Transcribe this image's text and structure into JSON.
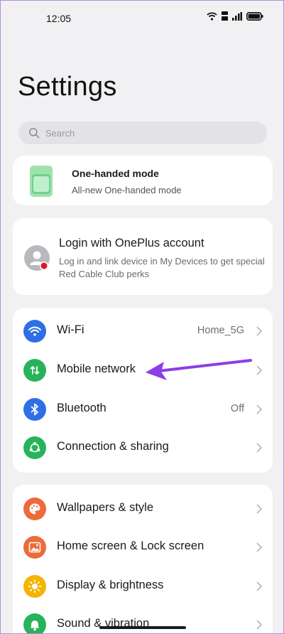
{
  "status_bar": {
    "time": "12:05"
  },
  "page": {
    "title": "Settings"
  },
  "search": {
    "placeholder": "Search"
  },
  "promo_card": {
    "title": "One-handed mode",
    "subtitle": "All-new One-handed mode"
  },
  "account_card": {
    "title": "Login with OnePlus account",
    "subtitle": "Log in and link device in My Devices to get special Red Cable Club perks"
  },
  "connectivity": [
    {
      "label": "Wi-Fi",
      "value": "Home_5G",
      "icon": "wifi-icon",
      "color": "#2f6fe4"
    },
    {
      "label": "Mobile network",
      "value": "",
      "icon": "mobile-data-icon",
      "color": "#27b35a"
    },
    {
      "label": "Bluetooth",
      "value": "Off",
      "icon": "bluetooth-icon",
      "color": "#2f6fe4"
    },
    {
      "label": "Connection & sharing",
      "value": "",
      "icon": "share-icon",
      "color": "#27b35a"
    }
  ],
  "personalization": [
    {
      "label": "Wallpapers & style",
      "icon": "palette-icon",
      "color": "#ee6a3a"
    },
    {
      "label": "Home screen & Lock screen",
      "icon": "image-icon",
      "color": "#ee6a3a"
    },
    {
      "label": "Display & brightness",
      "icon": "brightness-icon",
      "color": "#f4b400"
    },
    {
      "label": "Sound & vibration",
      "icon": "bell-icon",
      "color": "#27b35a"
    }
  ],
  "colors": {
    "accent_purple": "#8a3ee8",
    "background": "#f1f1f3",
    "card": "#ffffff"
  }
}
